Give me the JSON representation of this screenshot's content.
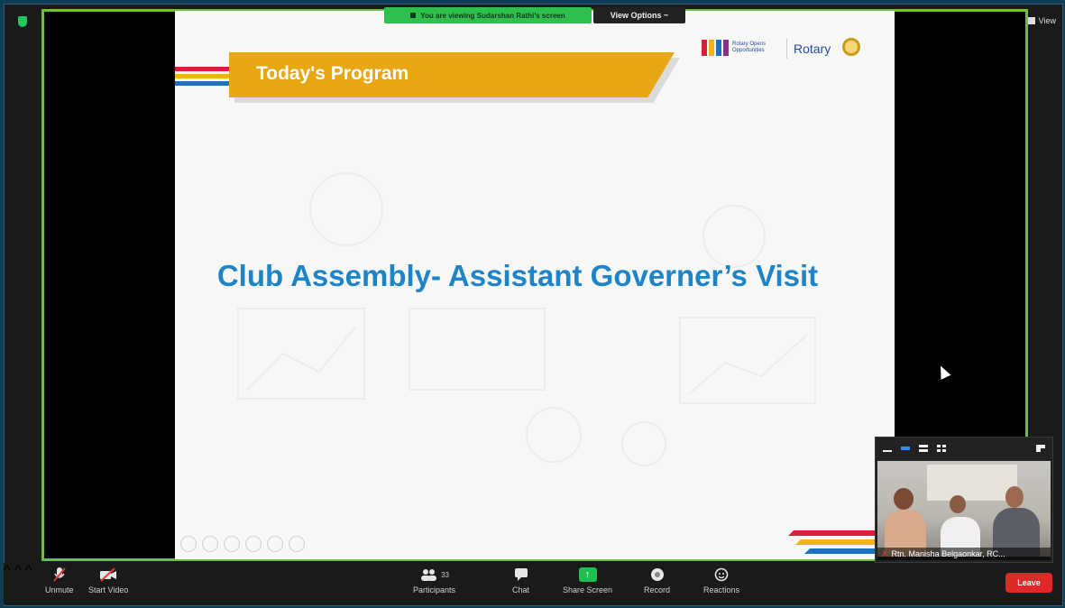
{
  "meeting": {
    "share_banner": "You are viewing Sudarshan Rathi's screen",
    "view_options": "View Options ~",
    "view_label": "View"
  },
  "slide": {
    "program_title": "Today's Program",
    "main_title": "Club Assembly- Assistant Governer’s Visit",
    "logo_tagline": "Rotary Opens Opportunities",
    "logo_brand": "Rotary"
  },
  "thumbnail": {
    "participant_name": "Rtn. Manisha Belgaonkar, RC..."
  },
  "toolbar": {
    "unmute": "Unmute",
    "start_video": "Start Video",
    "participants": "Participants",
    "participants_count": "33",
    "chat": "Chat",
    "share_screen": "Share Screen",
    "record": "Record",
    "reactions": "Reactions",
    "leave": "Leave"
  },
  "colors": {
    "accent_green": "#6fbf3f",
    "title_blue": "#1d84c7",
    "band_gold": "#e8a713",
    "leave_red": "#e02828"
  }
}
